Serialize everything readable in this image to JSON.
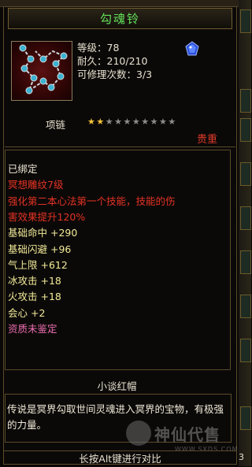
{
  "item": {
    "name": "勾魂铃",
    "level": "等级：78",
    "durability": "耐久：210/210",
    "repairs": "可修理次数：3/3",
    "type": "项链",
    "stars_filled": 2,
    "stars_total": 10,
    "quality": "贵重"
  },
  "properties": [
    {
      "text": "已绑定",
      "color": "white"
    },
    {
      "text": "冥想雕纹7级",
      "color": "red"
    },
    {
      "text": "强化第二本心法第一个技能，技能的伤",
      "color": "red"
    },
    {
      "text": "害效果提升120%",
      "color": "red"
    },
    {
      "text": "基础命中 +290",
      "color": "yellow"
    },
    {
      "text": "基础闪避 +96",
      "color": "yellow"
    },
    {
      "text": "气上限 +612",
      "color": "yellow"
    },
    {
      "text": "冰攻击 +18",
      "color": "yellow"
    },
    {
      "text": "火攻击 +18",
      "color": "yellow"
    },
    {
      "text": "会心 +2",
      "color": "yellow"
    },
    {
      "text": "资质未鉴定",
      "color": "pink"
    }
  ],
  "maker": "小谈红帽",
  "description": "传说是冥界勾取世间灵魂进入冥界的宝物，有极强的力量。",
  "compare_hint": "长按Alt键进行对比",
  "watermark": {
    "name": "神仙代售",
    "url": "WWW.SXDS.COM"
  },
  "corner_number": "3",
  "icons": {
    "item_icon": "chain-necklace-icon",
    "gem_icon": "sapphire-icon"
  },
  "colors": {
    "title": "#63e05a",
    "quality": "#e13a2a",
    "red_text": "#e53224",
    "yellow_text": "#f2ea98",
    "pink_text": "#ee6fb0",
    "border": "#5a4a2a"
  }
}
